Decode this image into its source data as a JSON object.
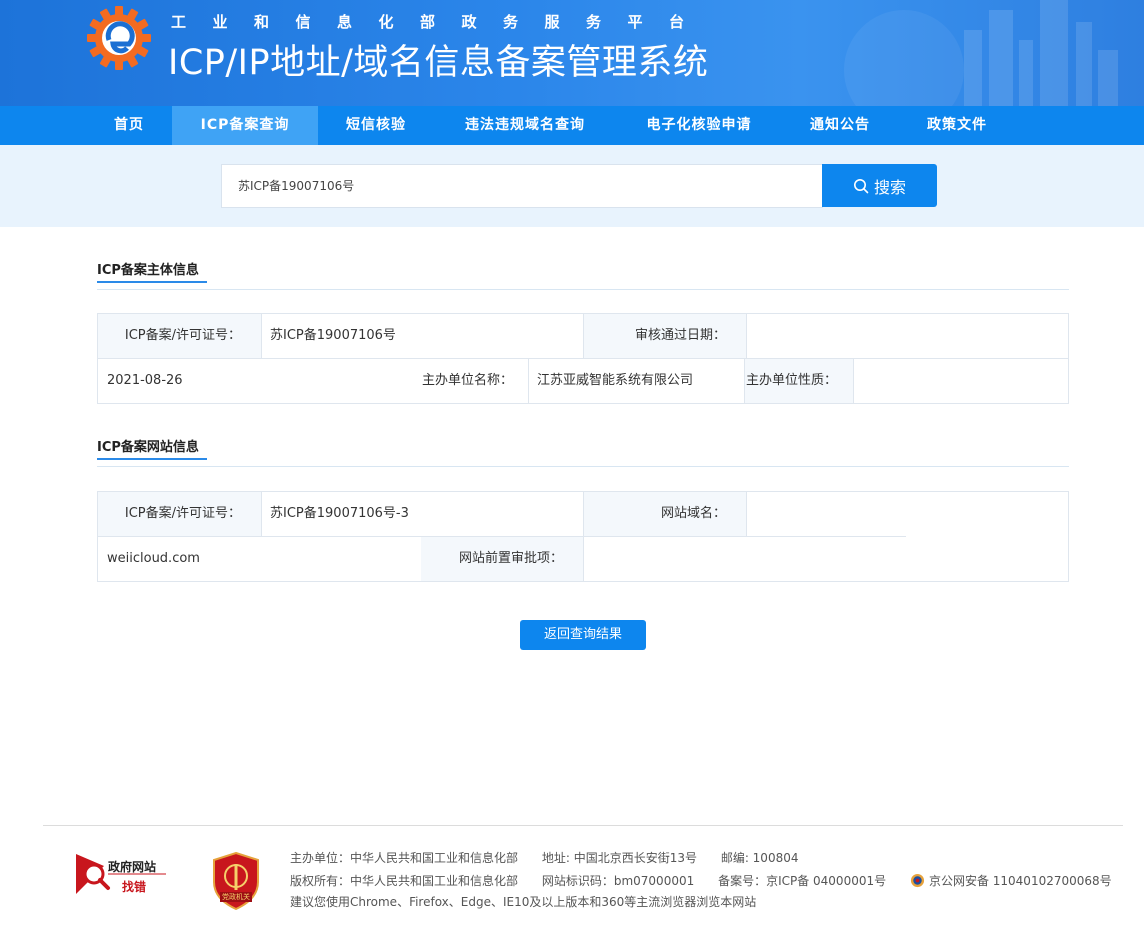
{
  "header": {
    "subtitle": "工业和信息化部政务服务平台",
    "title": "ICP/IP地址/域名信息备案管理系统"
  },
  "nav": {
    "items": [
      {
        "label": "首页"
      },
      {
        "label": "ICP备案查询",
        "active": true
      },
      {
        "label": "短信核验"
      },
      {
        "label": "违法违规域名查询"
      },
      {
        "label": "电子化核验申请"
      },
      {
        "label": "通知公告"
      },
      {
        "label": "政策文件"
      }
    ]
  },
  "search": {
    "value": "苏ICP备19007106号",
    "button_label": "搜索"
  },
  "subject_section": {
    "title": "ICP备案主体信息",
    "icp_label": "ICP备案/许可证号：",
    "icp_value": "苏ICP备19007106号",
    "approve_date_label": "审核通过日期：",
    "approve_date_value": "2021-08-26",
    "org_name_label": "主办单位名称：",
    "org_name_value": "江苏亚威智能系统有限公司",
    "org_nature_label": "主办单位性质：",
    "org_nature_value": ""
  },
  "website_section": {
    "title": "ICP备案网站信息",
    "icp_label": "ICP备案/许可证号：",
    "icp_value": "苏ICP备19007106号-3",
    "domain_label": "网站域名：",
    "domain_value": "weiicloud.com",
    "preapproval_label": "网站前置审批项：",
    "preapproval_value": ""
  },
  "back_button_label": "返回查询结果",
  "footer": {
    "gov_badge_top": "政府网站",
    "gov_badge_bottom": "找错",
    "party_badge_text": "党政机关",
    "line1": {
      "sponsor": "主办单位：中华人民共和国工业和信息化部",
      "address": "地址: 中国北京西长安街13号",
      "postcode": "邮编: 100804"
    },
    "line2": {
      "copyright": "版权所有：中华人民共和国工业和信息化部",
      "site_code": "网站标识码：bm07000001",
      "icp": "备案号：京ICP备 04000001号",
      "police": "京公网安备 11040102700068号"
    },
    "line3": "建议您使用Chrome、Firefox、Edge、IE10及以上版本和360等主流浏览器浏览本网站"
  },
  "colors": {
    "primary": "#0d86ee",
    "nav_active": "#3fa3f5",
    "search_band": "#e8f3fd",
    "label_bg": "#f4f8fc"
  }
}
